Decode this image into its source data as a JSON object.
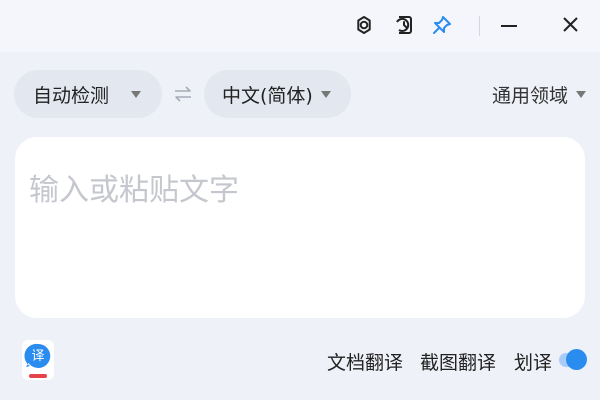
{
  "titlebar": {
    "buttons": [
      {
        "name": "settings-button",
        "icon": "gear-icon"
      },
      {
        "name": "history-button",
        "icon": "history-icon"
      },
      {
        "name": "pin-button",
        "icon": "pin-icon",
        "color": "#2b8cf0"
      },
      {
        "name": "minimize-button",
        "icon": "minimize-icon"
      },
      {
        "name": "close-button",
        "icon": "close-icon"
      }
    ]
  },
  "languages": {
    "source": "自动检测",
    "swap_icon": "swap-arrows-icon",
    "target": "中文(简体)",
    "domain": "通用领域"
  },
  "input": {
    "placeholder": "输入或粘贴文字",
    "value": ""
  },
  "footer": {
    "logo_icon": "translate-logo-icon",
    "document_translate": "文档翻译",
    "screenshot_translate": "截图翻译",
    "selection_translate": "划译",
    "selection_toggle_on": true
  },
  "colors": {
    "background": "#eef1f8",
    "card": "#ffffff",
    "accent": "#2b8cf0",
    "pill": "#e3e7ef"
  }
}
